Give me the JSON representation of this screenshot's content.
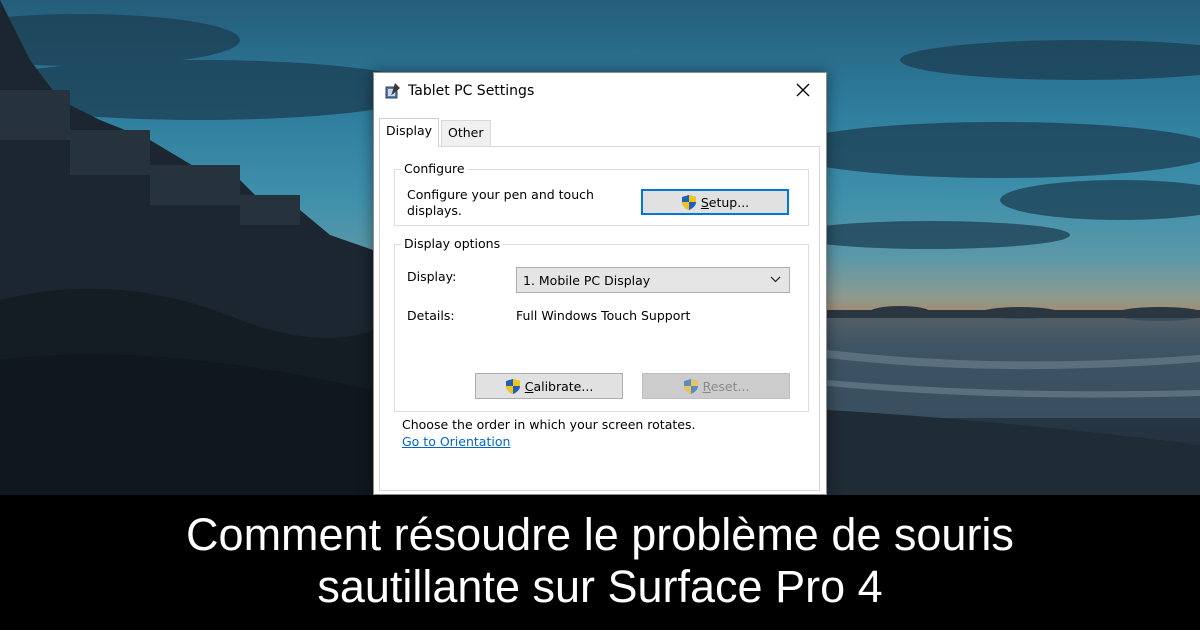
{
  "window": {
    "title": "Tablet PC Settings",
    "icon": "tablet-pen-icon",
    "close_icon": "close-icon"
  },
  "tabs": [
    {
      "label": "Display",
      "active": true
    },
    {
      "label": "Other",
      "active": false
    }
  ],
  "configure": {
    "group_label": "Configure",
    "description_line1": "Configure your pen and touch",
    "description_line2": "displays.",
    "setup_button": {
      "prefix": "",
      "underlined": "S",
      "rest": "etup...",
      "icon": "uac-shield-icon"
    }
  },
  "display_options": {
    "group_label": "Display options",
    "display_label": "Display:",
    "display_value": "1. Mobile PC Display",
    "details_label": "Details:",
    "details_value": "Full Windows Touch Support",
    "calibrate_button": {
      "underlined": "C",
      "rest": "alibrate...",
      "icon": "uac-shield-icon"
    },
    "reset_button": {
      "underlined": "R",
      "rest": "eset...",
      "icon": "uac-shield-icon",
      "disabled": true
    }
  },
  "orientation": {
    "text": "Choose the order in which your screen rotates.",
    "link": "Go to Orientation"
  },
  "caption": {
    "line1": "Comment résoudre le problème de souris",
    "line2": "sautillante sur Surface Pro 4"
  },
  "colors": {
    "caption_bg": "#000000",
    "caption_text": "#ffffff",
    "link": "#0066cc",
    "default_button_border": "#0078d7"
  }
}
